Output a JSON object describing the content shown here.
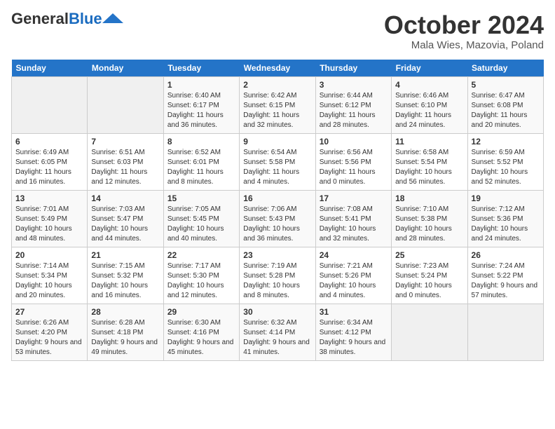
{
  "header": {
    "logo_general": "General",
    "logo_blue": "Blue",
    "month_title": "October 2024",
    "location": "Mala Wies, Mazovia, Poland"
  },
  "days_of_week": [
    "Sunday",
    "Monday",
    "Tuesday",
    "Wednesday",
    "Thursday",
    "Friday",
    "Saturday"
  ],
  "weeks": [
    [
      {
        "day": "",
        "empty": true
      },
      {
        "day": "",
        "empty": true
      },
      {
        "day": "1",
        "rise": "Sunrise: 6:40 AM",
        "set": "Sunset: 6:17 PM",
        "daylight": "Daylight: 11 hours and 36 minutes."
      },
      {
        "day": "2",
        "rise": "Sunrise: 6:42 AM",
        "set": "Sunset: 6:15 PM",
        "daylight": "Daylight: 11 hours and 32 minutes."
      },
      {
        "day": "3",
        "rise": "Sunrise: 6:44 AM",
        "set": "Sunset: 6:12 PM",
        "daylight": "Daylight: 11 hours and 28 minutes."
      },
      {
        "day": "4",
        "rise": "Sunrise: 6:46 AM",
        "set": "Sunset: 6:10 PM",
        "daylight": "Daylight: 11 hours and 24 minutes."
      },
      {
        "day": "5",
        "rise": "Sunrise: 6:47 AM",
        "set": "Sunset: 6:08 PM",
        "daylight": "Daylight: 11 hours and 20 minutes."
      }
    ],
    [
      {
        "day": "6",
        "rise": "Sunrise: 6:49 AM",
        "set": "Sunset: 6:05 PM",
        "daylight": "Daylight: 11 hours and 16 minutes."
      },
      {
        "day": "7",
        "rise": "Sunrise: 6:51 AM",
        "set": "Sunset: 6:03 PM",
        "daylight": "Daylight: 11 hours and 12 minutes."
      },
      {
        "day": "8",
        "rise": "Sunrise: 6:52 AM",
        "set": "Sunset: 6:01 PM",
        "daylight": "Daylight: 11 hours and 8 minutes."
      },
      {
        "day": "9",
        "rise": "Sunrise: 6:54 AM",
        "set": "Sunset: 5:58 PM",
        "daylight": "Daylight: 11 hours and 4 minutes."
      },
      {
        "day": "10",
        "rise": "Sunrise: 6:56 AM",
        "set": "Sunset: 5:56 PM",
        "daylight": "Daylight: 11 hours and 0 minutes."
      },
      {
        "day": "11",
        "rise": "Sunrise: 6:58 AM",
        "set": "Sunset: 5:54 PM",
        "daylight": "Daylight: 10 hours and 56 minutes."
      },
      {
        "day": "12",
        "rise": "Sunrise: 6:59 AM",
        "set": "Sunset: 5:52 PM",
        "daylight": "Daylight: 10 hours and 52 minutes."
      }
    ],
    [
      {
        "day": "13",
        "rise": "Sunrise: 7:01 AM",
        "set": "Sunset: 5:49 PM",
        "daylight": "Daylight: 10 hours and 48 minutes."
      },
      {
        "day": "14",
        "rise": "Sunrise: 7:03 AM",
        "set": "Sunset: 5:47 PM",
        "daylight": "Daylight: 10 hours and 44 minutes."
      },
      {
        "day": "15",
        "rise": "Sunrise: 7:05 AM",
        "set": "Sunset: 5:45 PM",
        "daylight": "Daylight: 10 hours and 40 minutes."
      },
      {
        "day": "16",
        "rise": "Sunrise: 7:06 AM",
        "set": "Sunset: 5:43 PM",
        "daylight": "Daylight: 10 hours and 36 minutes."
      },
      {
        "day": "17",
        "rise": "Sunrise: 7:08 AM",
        "set": "Sunset: 5:41 PM",
        "daylight": "Daylight: 10 hours and 32 minutes."
      },
      {
        "day": "18",
        "rise": "Sunrise: 7:10 AM",
        "set": "Sunset: 5:38 PM",
        "daylight": "Daylight: 10 hours and 28 minutes."
      },
      {
        "day": "19",
        "rise": "Sunrise: 7:12 AM",
        "set": "Sunset: 5:36 PM",
        "daylight": "Daylight: 10 hours and 24 minutes."
      }
    ],
    [
      {
        "day": "20",
        "rise": "Sunrise: 7:14 AM",
        "set": "Sunset: 5:34 PM",
        "daylight": "Daylight: 10 hours and 20 minutes."
      },
      {
        "day": "21",
        "rise": "Sunrise: 7:15 AM",
        "set": "Sunset: 5:32 PM",
        "daylight": "Daylight: 10 hours and 16 minutes."
      },
      {
        "day": "22",
        "rise": "Sunrise: 7:17 AM",
        "set": "Sunset: 5:30 PM",
        "daylight": "Daylight: 10 hours and 12 minutes."
      },
      {
        "day": "23",
        "rise": "Sunrise: 7:19 AM",
        "set": "Sunset: 5:28 PM",
        "daylight": "Daylight: 10 hours and 8 minutes."
      },
      {
        "day": "24",
        "rise": "Sunrise: 7:21 AM",
        "set": "Sunset: 5:26 PM",
        "daylight": "Daylight: 10 hours and 4 minutes."
      },
      {
        "day": "25",
        "rise": "Sunrise: 7:23 AM",
        "set": "Sunset: 5:24 PM",
        "daylight": "Daylight: 10 hours and 0 minutes."
      },
      {
        "day": "26",
        "rise": "Sunrise: 7:24 AM",
        "set": "Sunset: 5:22 PM",
        "daylight": "Daylight: 9 hours and 57 minutes."
      }
    ],
    [
      {
        "day": "27",
        "rise": "Sunrise: 6:26 AM",
        "set": "Sunset: 4:20 PM",
        "daylight": "Daylight: 9 hours and 53 minutes."
      },
      {
        "day": "28",
        "rise": "Sunrise: 6:28 AM",
        "set": "Sunset: 4:18 PM",
        "daylight": "Daylight: 9 hours and 49 minutes."
      },
      {
        "day": "29",
        "rise": "Sunrise: 6:30 AM",
        "set": "Sunset: 4:16 PM",
        "daylight": "Daylight: 9 hours and 45 minutes."
      },
      {
        "day": "30",
        "rise": "Sunrise: 6:32 AM",
        "set": "Sunset: 4:14 PM",
        "daylight": "Daylight: 9 hours and 41 minutes."
      },
      {
        "day": "31",
        "rise": "Sunrise: 6:34 AM",
        "set": "Sunset: 4:12 PM",
        "daylight": "Daylight: 9 hours and 38 minutes."
      },
      {
        "day": "",
        "empty": true
      },
      {
        "day": "",
        "empty": true
      }
    ]
  ]
}
